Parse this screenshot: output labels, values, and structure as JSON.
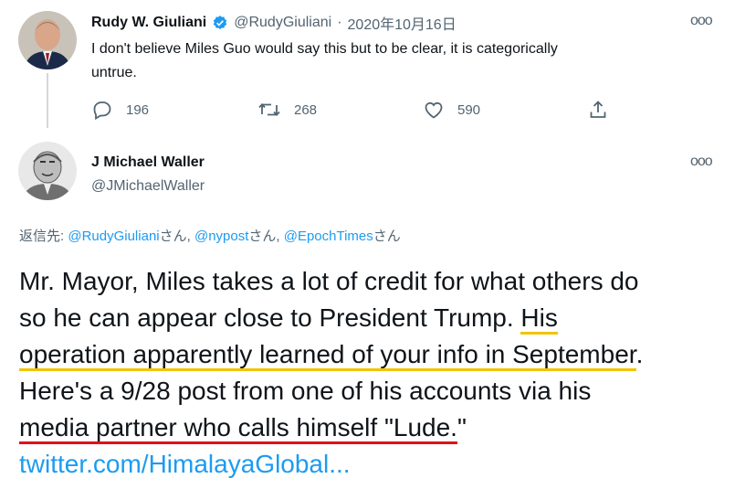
{
  "tweet1": {
    "name": "Rudy W. Giuliani",
    "handle": "@RudyGiuliani",
    "separator": "·",
    "date": "2020年10月16日",
    "text_line1": "I don't believe Miles Guo would say this but to be clear, it is categorically",
    "text_line2": "untrue.",
    "more_label": "ooo",
    "actions": {
      "reply_count": "196",
      "retweet_count": "268",
      "like_count": "590"
    }
  },
  "tweet2": {
    "name": "J Michael Waller",
    "handle": "@JMichaelWaller",
    "more_label": "ooo",
    "reply_prefix": "返信先: ",
    "reply_mentions": [
      {
        "handle": "@RudyGiuliani",
        "suffix": "さん, "
      },
      {
        "handle": "@nypost",
        "suffix": "さん, "
      },
      {
        "handle": "@EpochTimes",
        "suffix": "さん"
      }
    ],
    "body": {
      "line1": "Mr. Mayor, Miles takes a lot of credit for what others do",
      "line2_plain": "so he can appear close to President Trump. ",
      "line2_highlight": "His",
      "line3_highlight": "operation apparently learned of your info in September",
      "line3_end": ".",
      "line4": "Here's a 9/28 post from one of his accounts via his",
      "line5_highlight": "media partner who calls himself \"Lude.",
      "line5_end": "\"",
      "link": "twitter.com/HimalayaGlobal..."
    }
  },
  "colors": {
    "accent": "#1d9bf0",
    "verified": "#1d9bf0",
    "underline_yellow": "#f2c400",
    "underline_red": "#e0121b"
  }
}
